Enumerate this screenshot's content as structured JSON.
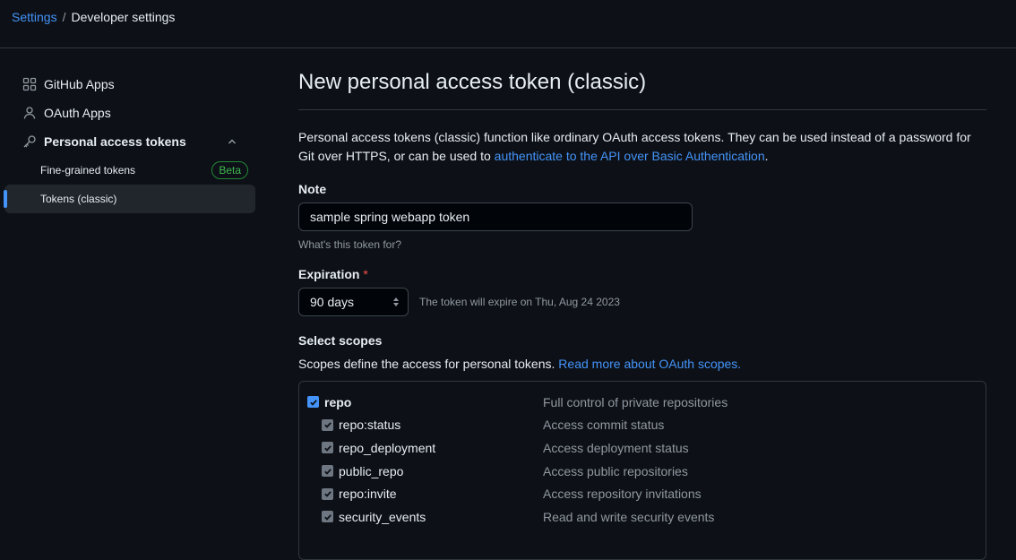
{
  "breadcrumb": {
    "settings": "Settings",
    "separator": "/",
    "current": "Developer settings"
  },
  "sidebar": {
    "items": [
      {
        "label": "GitHub Apps",
        "icon": "apps-icon"
      },
      {
        "label": "OAuth Apps",
        "icon": "person-icon"
      },
      {
        "label": "Personal access tokens",
        "icon": "key-icon",
        "expanded": true
      }
    ],
    "subitems": [
      {
        "label": "Fine-grained tokens",
        "badge": "Beta"
      },
      {
        "label": "Tokens (classic)",
        "active": true
      }
    ]
  },
  "main": {
    "title": "New personal access token (classic)",
    "intro_text": "Personal access tokens (classic) function like ordinary OAuth access tokens. They can be used instead of a password for Git over HTTPS, or can be used to ",
    "intro_link": "authenticate to the API over Basic Authentication",
    "intro_end": ".",
    "note_label": "Note",
    "note_value": "sample spring webapp token",
    "note_hint": "What's this token for?",
    "expiration_label": "Expiration",
    "expiration_required": "*",
    "expiration_value": "90 days",
    "expiration_note": "The token will expire on Thu, Aug 24 2023",
    "scopes_label": "Select scopes",
    "scopes_desc": "Scopes define the access for personal tokens.",
    "scopes_link": "Read more about OAuth scopes."
  },
  "scopes": [
    {
      "name": "repo",
      "desc": "Full control of private repositories",
      "checked": true,
      "parent": true
    },
    {
      "name": "repo:status",
      "desc": "Access commit status",
      "checked": true,
      "parent": false
    },
    {
      "name": "repo_deployment",
      "desc": "Access deployment status",
      "checked": true,
      "parent": false
    },
    {
      "name": "public_repo",
      "desc": "Access public repositories",
      "checked": true,
      "parent": false
    },
    {
      "name": "repo:invite",
      "desc": "Access repository invitations",
      "checked": true,
      "parent": false
    },
    {
      "name": "security_events",
      "desc": "Read and write security events",
      "checked": true,
      "parent": false
    }
  ],
  "colors": {
    "background": "#0d1117",
    "link": "#4493f8",
    "border": "#30363d",
    "muted": "#9198a1",
    "beta_green": "#3fb950",
    "required_red": "#f85149"
  }
}
